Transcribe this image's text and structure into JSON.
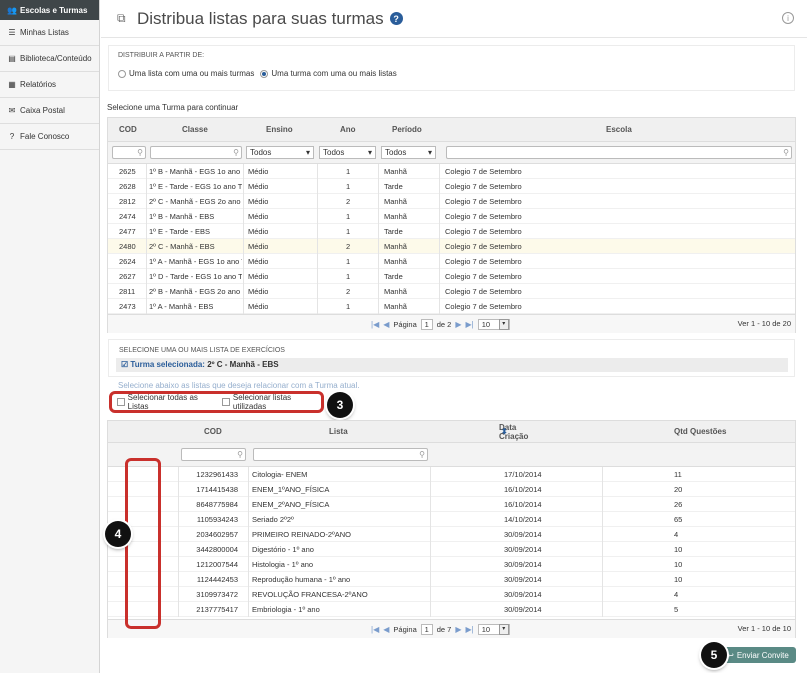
{
  "sidebar": {
    "items": [
      {
        "label": "Escolas e Turmas",
        "icon": "users-icon"
      },
      {
        "label": "Minhas Listas",
        "icon": "list-icon"
      },
      {
        "label": "Biblioteca/Conteúdo",
        "icon": "book-icon"
      },
      {
        "label": "Relatórios",
        "icon": "chart-icon"
      },
      {
        "label": "Caixa Postal",
        "icon": "envelope-icon"
      },
      {
        "label": "Fale Conosco",
        "icon": "question-icon"
      }
    ]
  },
  "header": {
    "title": "Distribua listas para suas turmas"
  },
  "distrib": {
    "label": "DISTRIBUIR A PARTIR DE:",
    "option1": "Uma lista com uma ou mais turmas",
    "option2": "Uma turma com uma ou mais listas",
    "selected": 2
  },
  "turma_prompt": "Selecione uma Turma para continuar",
  "turmas_grid": {
    "columns": [
      "COD",
      "Classe",
      "Ensino",
      "Ano",
      "Período",
      "Escola"
    ],
    "filters": {
      "ensino": "Todos",
      "ano": "Todos",
      "periodo": "Todos"
    },
    "rows": [
      [
        "2625",
        "1º B - Manhã - EGS 1o ano T",
        "Médio",
        "1",
        "Manhã",
        "Colegio 7 de Setembro"
      ],
      [
        "2628",
        "1º E - Tarde - EGS 1o ano T5",
        "Médio",
        "1",
        "Tarde",
        "Colegio 7 de Setembro"
      ],
      [
        "2812",
        "2º C - Manhã - EGS 2o ano T",
        "Médio",
        "2",
        "Manhã",
        "Colegio 7 de Setembro"
      ],
      [
        "2474",
        "1º B - Manhã - EBS",
        "Médio",
        "1",
        "Manhã",
        "Colegio 7 de Setembro"
      ],
      [
        "2477",
        "1º E - Tarde - EBS",
        "Médio",
        "1",
        "Tarde",
        "Colegio 7 de Setembro"
      ],
      [
        "2480",
        "2º C - Manhã - EBS",
        "Médio",
        "2",
        "Manhã",
        "Colegio 7 de Setembro"
      ],
      [
        "2624",
        "1º A - Manhã - EGS 1o ano T",
        "Médio",
        "1",
        "Manhã",
        "Colegio 7 de Setembro"
      ],
      [
        "2627",
        "1º D - Tarde - EGS 1o ano T4",
        "Médio",
        "1",
        "Tarde",
        "Colegio 7 de Setembro"
      ],
      [
        "2811",
        "2º B - Manhã - EGS 2o ano T",
        "Médio",
        "2",
        "Manhã",
        "Colegio 7 de Setembro"
      ],
      [
        "2473",
        "1º A - Manhã - EBS",
        "Médio",
        "1",
        "Manhã",
        "Colegio 7 de Setembro"
      ]
    ],
    "selected_row": 5,
    "pager": {
      "page_label": "Página",
      "page": "1",
      "of": "de 2",
      "per_page": "10",
      "records": "Ver 1 - 10 de 20"
    }
  },
  "lists_section": {
    "label": "SELECIONE UMA OU MAIS LISTA DE EXERCÍCIOS",
    "turma_prefix": "Turma selecionada:",
    "turma_value": "2º C - Manhã - EBS",
    "hint": "Selecione abaixo as listas que deseja relacionar com a Turma atual.",
    "select_all": "Selecionar todas as Listas",
    "select_used": "Selecionar listas utilizadas"
  },
  "lists_grid": {
    "columns": [
      "COD",
      "Lista",
      "Data Criação",
      "Qtd Questões"
    ],
    "sort_icon": "sort-icon",
    "rows": [
      {
        "checked": false,
        "cod": "1232961433",
        "lista": "Citologia- ENEM",
        "data": "17/10/2014",
        "qtd": "11"
      },
      {
        "checked": false,
        "cod": "1714415438",
        "lista": "ENEM_1ºANO_FÍSICA",
        "data": "16/10/2014",
        "qtd": "20"
      },
      {
        "checked": true,
        "cod": "8648775984",
        "lista": "ENEM_2ºANO_FÍSICA",
        "data": "16/10/2014",
        "qtd": "26"
      },
      {
        "checked": false,
        "cod": "1105934243",
        "lista": "Seriado 2º2º",
        "data": "14/10/2014",
        "qtd": "65"
      },
      {
        "checked": true,
        "cod": "2034602957",
        "lista": "PRIMEIRO REINADO-2ºANO",
        "data": "30/09/2014",
        "qtd": "4"
      },
      {
        "checked": false,
        "cod": "3442800004",
        "lista": "Digestório - 1º ano",
        "data": "30/09/2014",
        "qtd": "10"
      },
      {
        "checked": false,
        "cod": "1212007544",
        "lista": "Histologia - 1º ano",
        "data": "30/09/2014",
        "qtd": "10"
      },
      {
        "checked": false,
        "cod": "1124442453",
        "lista": "Reprodução humana - 1º ano",
        "data": "30/09/2014",
        "qtd": "10"
      },
      {
        "checked": true,
        "cod": "3109973472",
        "lista": "REVOLUÇÃO FRANCESA-2ºANO",
        "data": "30/09/2014",
        "qtd": "4"
      },
      {
        "checked": false,
        "cod": "2137775417",
        "lista": "Embriologia - 1º ano",
        "data": "30/09/2014",
        "qtd": "5"
      }
    ],
    "pager": {
      "page_label": "Página",
      "page": "1",
      "of": "de 7",
      "per_page": "10",
      "records": "Ver 1 - 10 de 10"
    }
  },
  "markers": {
    "m3": "3",
    "m4": "4",
    "m5": "5"
  },
  "send_button": "Enviar Convite",
  "colors": {
    "sidebar_active": "#3f4649",
    "highlight": "#c9302c",
    "link": "#2a5d9a",
    "send": "#5a8a85"
  }
}
